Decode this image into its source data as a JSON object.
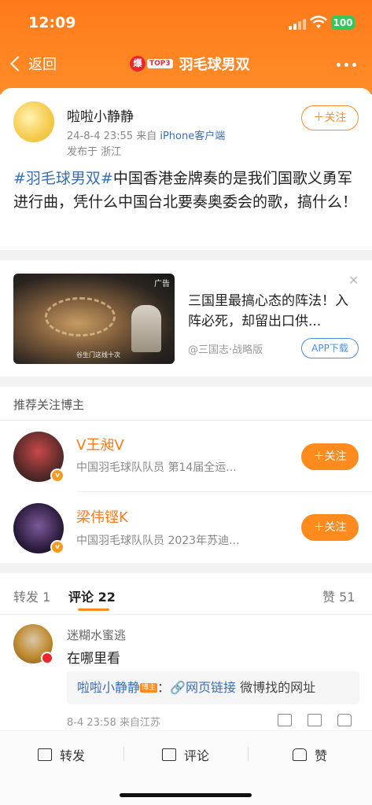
{
  "status_bar": {
    "time": "12:09",
    "battery": "100"
  },
  "nav": {
    "back_label": "返回",
    "hot_icon": "爆",
    "top_badge": "TOP3",
    "title": "羽毛球男双"
  },
  "post": {
    "username": "啦啦小静静",
    "date": "24-8-4 23:55",
    "from_prefix": "来自",
    "device": "iPhone客户端",
    "location": "发布于 浙江",
    "follow_label": "关注",
    "tag": "#羽毛球男双#",
    "text": "中国香港金牌奏的是我们国歌义勇军进行曲，凭什么中国台北要奏奥委会的歌，搞什么！"
  },
  "ad": {
    "badge": "广告",
    "image_caption": "谷生门这线十次",
    "title": "三国里最搞心态的阵法！入阵必死，却留出口供...",
    "source": "@三国志·战略版",
    "button": "APP下载"
  },
  "recommend": {
    "title": "推荐关注博主",
    "items": [
      {
        "name": "V王昶V",
        "desc": "中国羽毛球队队员 第14届全运...",
        "follow": "关注"
      },
      {
        "name": "梁伟铿K",
        "desc": "中国羽毛球队队员 2023年苏迪...",
        "follow": "关注"
      }
    ]
  },
  "comments": {
    "tabs": {
      "repost": "转发 1",
      "comment": "评论 22",
      "like": "赞 51"
    },
    "item": {
      "name": "迷糊水蜜逃",
      "text": "在哪里看",
      "reply_user": "啦啦小静静",
      "reply_badge": "博主",
      "reply_link": "网页链接",
      "reply_text": " 微博找的网址",
      "meta": "8-4 23:58 来自江苏"
    }
  },
  "bottom_bar": {
    "repost": "转发",
    "comment": "评论",
    "like": "赞"
  },
  "colors": {
    "brand_orange": "#ff8a1e",
    "link_blue": "#3a6fb0"
  }
}
